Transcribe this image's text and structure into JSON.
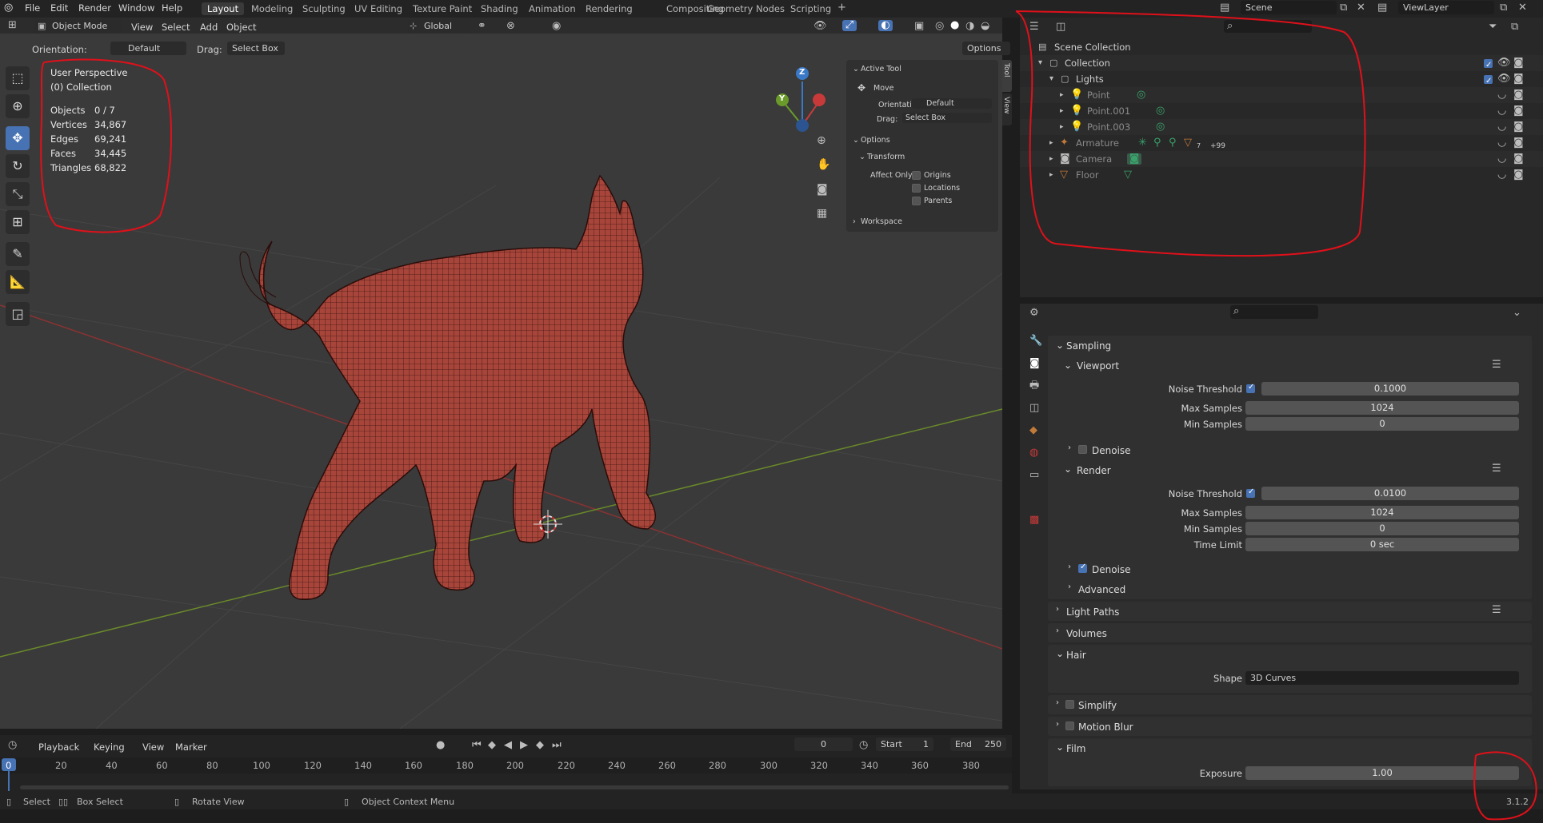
{
  "menus": [
    "File",
    "Edit",
    "Render",
    "Window",
    "Help"
  ],
  "workspaces": [
    "Layout",
    "Modeling",
    "Sculpting",
    "UV Editing",
    "Texture Paint",
    "Shading",
    "Animation",
    "Rendering",
    "Compositing",
    "Geometry Nodes",
    "Scripting"
  ],
  "scene": "Scene",
  "view_layer": "ViewLayer",
  "viewport_header": {
    "mode": "Object Mode",
    "menus": [
      "View",
      "Select",
      "Add",
      "Object"
    ],
    "transform": "Global",
    "options": "Options"
  },
  "subheader": {
    "orientation_label": "Orientation:",
    "orientation": "Default",
    "drag_label": "Drag:",
    "drag": "Select Box"
  },
  "overlay": {
    "perspective": "User Perspective",
    "collection": "(0) Collection"
  },
  "stats": [
    {
      "label": "Objects",
      "value": "0 / 7"
    },
    {
      "label": "Vertices",
      "value": "34,867"
    },
    {
      "label": "Edges",
      "value": "69,241"
    },
    {
      "label": "Faces",
      "value": "34,445"
    },
    {
      "label": "Triangles",
      "value": "68,822"
    }
  ],
  "gizmo": {
    "z": "Z",
    "y": "Y"
  },
  "npanel": {
    "tabs": [
      "Tool",
      "View"
    ],
    "active_tool": "Active Tool",
    "tool": "Move",
    "orientation_label": "Orientation",
    "orientation": "Default",
    "drag_label": "Drag:",
    "drag": "Select Box",
    "options": "Options",
    "transform": "Transform",
    "affect_only": "Affect Only",
    "affect_items": [
      "Origins",
      "Locations",
      "Parents"
    ],
    "workspace": "Workspace"
  },
  "outliner": {
    "root": "Scene Collection",
    "collection": "Collection",
    "lights": "Lights",
    "lamps": [
      "Point",
      "Point.001",
      "Point.003"
    ],
    "objects": [
      "Armature",
      "Camera",
      "Floor"
    ],
    "armature_count": "7",
    "armature_more": "+99"
  },
  "properties": {
    "sampling": "Sampling",
    "viewport": "Viewport",
    "render": "Render",
    "noise_threshold_label": "Noise Threshold",
    "max_samples_label": "Max Samples",
    "min_samples_label": "Min Samples",
    "time_limit_label": "Time Limit",
    "viewport_noise": "0.1000",
    "viewport_max": "1024",
    "viewport_min": "0",
    "render_noise": "0.0100",
    "render_max": "1024",
    "render_min": "0",
    "time_limit": "0 sec",
    "denoise": "Denoise",
    "advanced": "Advanced",
    "light_paths": "Light Paths",
    "volumes": "Volumes",
    "hair": "Hair",
    "shape_label": "Shape",
    "shape": "3D Curves",
    "simplify": "Simplify",
    "motion_blur": "Motion Blur",
    "film": "Film",
    "exposure_label": "Exposure",
    "exposure": "1.00"
  },
  "timeline": {
    "menus": [
      "Playback",
      "Keying",
      "View",
      "Marker"
    ],
    "current": "0",
    "start_label": "Start",
    "start": "1",
    "end_label": "End",
    "end": "250",
    "ticks": [
      "0",
      "20",
      "40",
      "60",
      "80",
      "100",
      "120",
      "140",
      "160",
      "180",
      "200",
      "220",
      "240",
      "260",
      "280",
      "300",
      "320",
      "340",
      "360",
      "380"
    ]
  },
  "status": {
    "select": "Select",
    "box_select": "Box Select",
    "rotate": "Rotate View",
    "context": "Object Context Menu",
    "version": "3.1.2"
  },
  "colors": {
    "accent": "#4772b3",
    "annotation": "#e0101a",
    "mesh": "#a8453a"
  }
}
